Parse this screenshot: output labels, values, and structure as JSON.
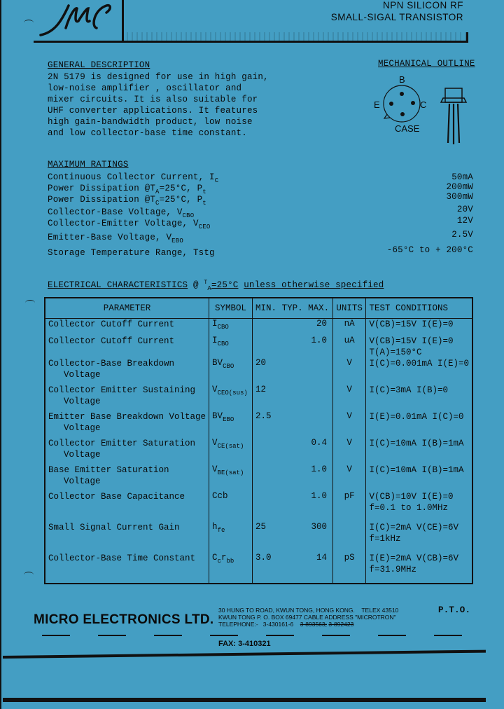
{
  "header": {
    "logo_text": "MEC",
    "title_line1": "NPN SILICON RF",
    "title_line2": "SMALL-SIGAL TRANSISTOR"
  },
  "general_description": {
    "heading": "GENERAL DESCRIPTION",
    "lines": [
      "2N 5179 is designed for use in high gain,",
      "low-noise amplifier , oscillator and",
      "mixer circuits.  It is also suitable for",
      "UHF converter applications.  It features",
      "high gain-bandwidth product, low noise",
      "and low collector-base time constant."
    ]
  },
  "mechanical_outline": {
    "heading": "MECHANICAL OUTLINE",
    "pin_b": "B",
    "pin_e": "E",
    "pin_c": "C",
    "case_label": "CASE"
  },
  "maximum_ratings": {
    "heading": "MAXIMUM RATINGS",
    "rows": [
      {
        "param": "Continuous Collector Current,",
        "sym": "I",
        "sub": "C",
        "value": "50mA"
      },
      {
        "param": "Power Dissipation  @T",
        "cond_sub": "A",
        "cond": "=25°C,",
        "sym": "P",
        "sub": "t",
        "value": "200mW"
      },
      {
        "param": "Power Dissipation  @T",
        "cond_sub": "C",
        "cond": "=25°C,",
        "sym": "P",
        "sub": "t",
        "value": "300mW"
      },
      {
        "param": "Collector-Base Voltage,",
        "sym": "V",
        "sub": "CBO",
        "value": "20V"
      },
      {
        "param": "Collector-Emitter Voltage,",
        "sym": "V",
        "sub": "CEO",
        "value": "12V"
      },
      {
        "param": "Emitter-Base Voltage,",
        "sym": "V",
        "sub": "EBO",
        "value": "2.5V"
      },
      {
        "param": "Storage Temperature Range,",
        "sym": "Tstg",
        "sub": "",
        "value": "-65°C to +  200°C"
      }
    ]
  },
  "electrical": {
    "heading_prefix": "ELECTRICAL CHARACTERISTICS",
    "heading_at": "@",
    "heading_cond_sym": "T",
    "heading_cond_sub": "A",
    "heading_cond": "=25°C",
    "heading_suffix": "unless otherwise specified",
    "columns": {
      "parameter": "PARAMETER",
      "symbol": "SYMBOL",
      "min": "MIN.",
      "typ": "TYP.",
      "max": "MAX.",
      "units": "UNITS",
      "test": "TEST CONDITIONS"
    },
    "rows": [
      {
        "p1": "Collector Cutoff Current",
        "p2": "",
        "sym": "I",
        "sub": "CBO",
        "min": "",
        "typ": "",
        "max": "20",
        "units": "nA",
        "t1": "V(CB)=15V    I(E)=0",
        "t2": ""
      },
      {
        "p1": "Collector Cutoff Current",
        "p2": "",
        "sym": "I",
        "sub": "CBO",
        "min": "",
        "typ": "",
        "max": "1.0",
        "units": "uA",
        "t1": "V(CB)=15V    I(E)=0",
        "t2": "T(A)=150°C"
      },
      {
        "p1": "Collector-Base Breakdown",
        "p2": "Voltage",
        "sym": "BV",
        "sub": "CBO",
        "min": "20",
        "typ": "",
        "max": "",
        "units": "V",
        "t1": "I(C)=0.001mA I(E)=0",
        "t2": ""
      },
      {
        "p1": "Collector Emitter Sustaining",
        "p2": "Voltage",
        "sym": "V",
        "sub": "CEO(sus)",
        "min": "12",
        "typ": "",
        "max": "",
        "units": "V",
        "t1": "I(C)=3mA     I(B)=0",
        "t2": ""
      },
      {
        "p1": "Emitter Base Breakdown Voltage",
        "p2": "Voltage",
        "sym": "BV",
        "sub": "EBO",
        "min": "2.5",
        "typ": "",
        "max": "",
        "units": "V",
        "t1": "I(E)=0.01mA  I(C)=0",
        "t2": ""
      },
      {
        "p1": "Collector Emitter Saturation",
        "p2": "Voltage",
        "sym": "V",
        "sub": "CE(sat)",
        "min": "",
        "typ": "",
        "max": "0.4",
        "units": "V",
        "t1": "I(C)=10mA    I(B)=1mA",
        "t2": ""
      },
      {
        "p1": "Base Emitter Saturation",
        "p2": "Voltage",
        "sym": "V",
        "sub": "BE(sat)",
        "min": "",
        "typ": "",
        "max": "1.0",
        "units": "V",
        "t1": "I(C)=10mA    I(B)=1mA",
        "t2": ""
      },
      {
        "p1": "Collector Base Capacitance",
        "p2": "",
        "sym": "Ccb",
        "sub": "",
        "min": "",
        "typ": "",
        "max": "1.0",
        "units": "pF",
        "t1": "V(CB)=10V    I(E)=0",
        "t2": "f=0.1 to 1.0MHz"
      },
      {
        "p1": "Small Signal Current Gain",
        "p2": "",
        "sym": "h",
        "sub": "fe",
        "min": "25",
        "typ": "",
        "max": "300",
        "units": "",
        "t1": "I(C)=2mA     V(CE)=6V",
        "t2": "f=1kHz"
      },
      {
        "p1": "Collector-Base Time Constant",
        "p2": "",
        "sym": "C",
        "sub": "c",
        "sym2": "r",
        "sub2": "bb",
        "min": "3.0",
        "typ": "",
        "max": "14",
        "units": "pS",
        "t1": "I(E)=2mA     V(CB)=6V",
        "t2": "f=31.9MHz"
      }
    ]
  },
  "footer": {
    "company": "MICRO ELECTRONICS LTD.",
    "address_line1": "30 HUNG TO ROAD, KWUN TONG, HONG KONG.",
    "address_line2": "KWUN TONG P. O. BOX 69477 CABLE ADDRESS",
    "telephone_label": "TELEPHONE:-",
    "telephone": "3-430161-6",
    "telephone_old1": "3-893563;",
    "telex": "TELEX 43510",
    "cable": "\"MICROTRON\"",
    "telephone_old2": "3-892423",
    "pto": "P.T.O.",
    "fax": "FAX: 3-410321"
  }
}
